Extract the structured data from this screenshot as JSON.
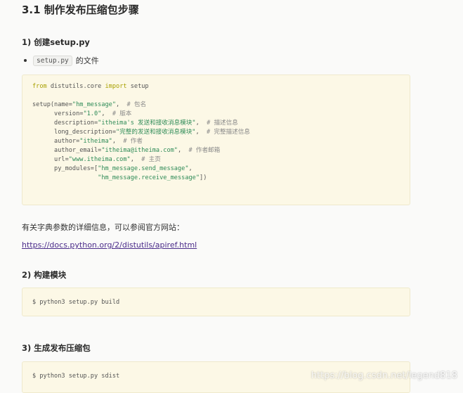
{
  "section_title": "3.1 制作发布压缩包步骤",
  "step1": {
    "heading": "1) 创建setup.py",
    "bullet_code": "setup.py",
    "bullet_text": "的文件"
  },
  "code_main": {
    "lines": [
      [
        {
          "t": "from",
          "c": "kw"
        },
        {
          "t": " distutils.core "
        },
        {
          "t": "import",
          "c": "kw"
        },
        {
          "t": " setup"
        }
      ],
      [],
      [
        {
          "t": "setup(name="
        },
        {
          "t": "\"hm_message\"",
          "c": "str"
        },
        {
          "t": ",  "
        },
        {
          "t": "# 包名",
          "c": "cm"
        }
      ],
      [
        {
          "t": "      version="
        },
        {
          "t": "\"1.0\"",
          "c": "str"
        },
        {
          "t": ",  "
        },
        {
          "t": "# 版本",
          "c": "cm"
        }
      ],
      [
        {
          "t": "      description="
        },
        {
          "t": "\"itheima's 发送和接收消息模块\"",
          "c": "str"
        },
        {
          "t": ",  "
        },
        {
          "t": "# 描述信息",
          "c": "cm"
        }
      ],
      [
        {
          "t": "      long_description="
        },
        {
          "t": "\"完整的发送和接收消息模块\"",
          "c": "str"
        },
        {
          "t": ",  "
        },
        {
          "t": "# 完整描述信息",
          "c": "cm"
        }
      ],
      [
        {
          "t": "      author="
        },
        {
          "t": "\"itheima\"",
          "c": "str"
        },
        {
          "t": ",  "
        },
        {
          "t": "# 作者",
          "c": "cm"
        }
      ],
      [
        {
          "t": "      author_email="
        },
        {
          "t": "\"itheima@itheima.com\"",
          "c": "str"
        },
        {
          "t": ",  "
        },
        {
          "t": "# 作者邮箱",
          "c": "cm"
        }
      ],
      [
        {
          "t": "      url="
        },
        {
          "t": "\"www.itheima.com\"",
          "c": "str"
        },
        {
          "t": ",  "
        },
        {
          "t": "# 主页",
          "c": "cm"
        }
      ],
      [
        {
          "t": "      py_modules=["
        },
        {
          "t": "\"hm_message.send_message\"",
          "c": "str"
        },
        {
          "t": ","
        }
      ],
      [
        {
          "t": "                  "
        },
        {
          "t": "\"hm_message.receive_message\"",
          "c": "str"
        },
        {
          "t": "])"
        }
      ]
    ]
  },
  "dict_note": "有关字典参数的详细信息，可以参阅官方网站：",
  "link_url": "https://docs.python.org/2/distutils/apiref.html",
  "step2": {
    "heading": "2) 构建模块",
    "command": "$ python3 setup.py build"
  },
  "step3": {
    "heading": "3) 生成发布压缩包",
    "command": "$ python3 setup.py sdist"
  },
  "watermark": "https://blog.csdn.net/legend818"
}
